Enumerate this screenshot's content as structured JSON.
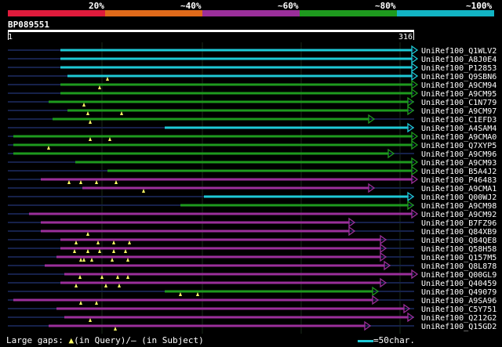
{
  "legend": {
    "labels": [
      "20%",
      "~40%",
      "~60%",
      "~80%",
      "~100%"
    ],
    "colors": [
      "#e01b3c",
      "#e06a1a",
      "#9b2f9b",
      "#1e9a1e",
      "#12b4c4"
    ]
  },
  "query": {
    "id": "BP089551",
    "start": "1",
    "end": "316",
    "length": 316
  },
  "hits": [
    {
      "id": "UniRef100_Q1WLV2",
      "start": 77,
      "end": 525,
      "color": "#1ec9d6",
      "gaps": []
    },
    {
      "id": "UniRef100_A8J0E4",
      "start": 77,
      "end": 525,
      "color": "#1ec9d6",
      "gaps": []
    },
    {
      "id": "UniRef100_P12853",
      "start": 77,
      "end": 525,
      "color": "#1ec9d6",
      "gaps": []
    },
    {
      "id": "UniRef100_Q9SBN6",
      "start": 86,
      "end": 525,
      "color": "#1ec9d6",
      "gaps": [
        137
      ]
    },
    {
      "id": "UniRef100_A9CM94",
      "start": 77,
      "end": 525,
      "color": "#1e9a1e",
      "gaps": [
        127
      ]
    },
    {
      "id": "UniRef100_A9CM95",
      "start": 77,
      "end": 525,
      "color": "#1e9a1e",
      "gaps": []
    },
    {
      "id": "UniRef100_C1N779",
      "start": 62,
      "end": 520,
      "color": "#1e9a1e",
      "gaps": [
        107
      ]
    },
    {
      "id": "UniRef100_A9CM97",
      "start": 86,
      "end": 520,
      "color": "#1e9a1e",
      "gaps": [
        155,
        112
      ]
    },
    {
      "id": "UniRef100_C1EFD3",
      "start": 67,
      "end": 470,
      "color": "#1e9a1e",
      "gaps": [
        115
      ]
    },
    {
      "id": "UniRef100_A4SAM4",
      "start": 210,
      "end": 520,
      "color": "#1ec9d6",
      "gaps": []
    },
    {
      "id": "UniRef100_A9CMA0",
      "start": 17,
      "end": 525,
      "color": "#1e9a1e",
      "gaps": [
        115,
        140
      ]
    },
    {
      "id": "UniRef100_Q7XYP5",
      "start": 17,
      "end": 525,
      "color": "#1e9a1e",
      "gaps": [
        62
      ]
    },
    {
      "id": "UniRef100_A9CM96",
      "start": 17,
      "end": 495,
      "color": "#1e9a1e",
      "gaps": []
    },
    {
      "id": "UniRef100_A9CM93",
      "start": 96,
      "end": 525,
      "color": "#1e9a1e",
      "gaps": []
    },
    {
      "id": "UniRef100_B5A4J2",
      "start": 137,
      "end": 525,
      "color": "#1e9a1e",
      "gaps": []
    },
    {
      "id": "UniRef100_P46483",
      "start": 52,
      "end": 525,
      "color": "#9b2f9b",
      "gaps": [
        88,
        103,
        123,
        148
      ]
    },
    {
      "id": "UniRef100_A9CMA1",
      "start": 105,
      "end": 470,
      "color": "#9b2f9b",
      "gaps": [
        183
      ]
    },
    {
      "id": "UniRef100_Q00WJ2",
      "start": 260,
      "end": 520,
      "color": "#1ec9d6",
      "gaps": []
    },
    {
      "id": "UniRef100_A9CM98",
      "start": 230,
      "end": 520,
      "color": "#1e9a1e",
      "gaps": []
    },
    {
      "id": "UniRef100_A9CM92",
      "start": 37,
      "end": 525,
      "color": "#9b2f9b",
      "gaps": []
    },
    {
      "id": "UniRef100_B7FZ96",
      "start": 52,
      "end": 445,
      "color": "#9b2f9b",
      "gaps": []
    },
    {
      "id": "UniRef100_Q84XB9",
      "start": 52,
      "end": 445,
      "color": "#9b2f9b",
      "gaps": [
        112
      ]
    },
    {
      "id": "UniRef100_Q84QE8",
      "start": 77,
      "end": 485,
      "color": "#9b2f9b",
      "gaps": [
        97,
        125,
        145,
        165
      ]
    },
    {
      "id": "UniRef100_Q58H58",
      "start": 77,
      "end": 485,
      "color": "#9b2f9b",
      "gaps": [
        95,
        112,
        127,
        145,
        160
      ]
    },
    {
      "id": "UniRef100_Q157M5",
      "start": 72,
      "end": 485,
      "color": "#9b2f9b",
      "gaps": [
        103,
        107,
        117,
        143,
        163
      ]
    },
    {
      "id": "UniRef100_Q8L878",
      "start": 57,
      "end": 490,
      "color": "#9b2f9b",
      "gaps": []
    },
    {
      "id": "UniRef100_Q00GL9",
      "start": 82,
      "end": 525,
      "color": "#9b2f9b",
      "gaps": [
        102,
        130,
        150,
        163
      ]
    },
    {
      "id": "UniRef100_Q40459",
      "start": 77,
      "end": 485,
      "color": "#9b2f9b",
      "gaps": [
        97,
        135,
        152
      ]
    },
    {
      "id": "UniRef100_Q49079",
      "start": 210,
      "end": 475,
      "color": "#1e9a1e",
      "gaps": [
        230,
        252
      ]
    },
    {
      "id": "UniRef100_A9SA96",
      "start": 17,
      "end": 475,
      "color": "#9b2f9b",
      "gaps": [
        103,
        123
      ]
    },
    {
      "id": "UniRef100_C5Y751",
      "start": 72,
      "end": 515,
      "color": "#9b2f9b",
      "gaps": []
    },
    {
      "id": "UniRef100_Q212G2",
      "start": 82,
      "end": 520,
      "color": "#9b2f9b",
      "gaps": [
        115
      ]
    },
    {
      "id": "UniRef100_Q15GD2",
      "start": 62,
      "end": 465,
      "color": "#9b2f9b",
      "gaps": [
        147
      ]
    }
  ],
  "footer": {
    "gap_text": "Large gaps: ",
    "in_query": "(in Query)/",
    "dash": "–",
    "in_subject": " (in Subject)",
    "scale_text": "=50char.",
    "scale_color": "#1ec9d6"
  }
}
